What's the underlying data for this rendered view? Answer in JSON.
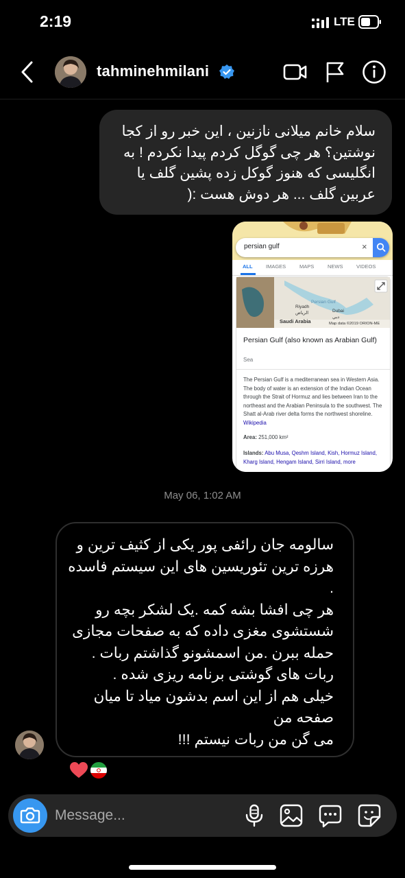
{
  "status": {
    "time": "2:19",
    "network": "LTE"
  },
  "header": {
    "username": "tahminehmilani"
  },
  "messages": {
    "outgoing_lines": [
      "سلام خانم میلانی نازنین ، این خبر رو از کجا",
      "نوشتین؟ هر چی گوگل کردم پیدا نکردم ! به",
      "انگلیسی که هنوز گوکل زده پشین گلف یا",
      "عربین گلف ... هر دوش هست :("
    ],
    "timestamp": "May 06, 1:02 AM",
    "incoming_lines": [
      "سالومه جان رائفی پور یکی از کثیف ترین و",
      "هرزه ترین تئوریسین های این سیستم فاسده",
      ".",
      "هر چی افشا بشه کمه .یک لشکر بچه رو",
      "شستشوی مغزی داده که به صفحات مجازی",
      "حمله ببرن .من اسمشونو گذاشتم ربات .",
      "ربات های گوشتی برنامه ریزی شده .",
      "خیلی هم از این اسم بدشون میاد تا میان",
      "صفحه من",
      "می گن من ربات نیستم !!!"
    ]
  },
  "screenshot": {
    "query": "persian gulf",
    "clear": "×",
    "tabs": [
      "ALL",
      "IMAGES",
      "MAPS",
      "NEWS",
      "VIDEOS"
    ],
    "map_labels": {
      "gulf": "Persian Gulf",
      "riyadh": "Riyadh",
      "riyadh_ar": "الرياض",
      "dubai": "Dubai",
      "dubai_ar": "دبي",
      "saudi": "Saudi Arabia",
      "credit": "Map data ©2019 ORION-ME"
    },
    "title": "Persian Gulf (also known as Arabian Gulf)",
    "subtitle": "Sea",
    "description": "The Persian Gulf is a mediterranean sea in Western Asia. The body of water is an extension of the Indian Ocean through the Strait of Hormuz and lies between Iran to the northeast and the Arabian Peninsula to the southwest. The Shatt al-Arab river delta forms the northwest shoreline.",
    "wiki": "Wikipedia",
    "area_label": "Area:",
    "area_value": "251,000 km²",
    "islands_label": "Islands:",
    "islands": "Abu Musa, Qeshm Island, Kish, Hormuz Island, Kharg Island, Hengam Island, Sirri Island, more"
  },
  "composer": {
    "placeholder": "Message..."
  },
  "colors": {
    "accent": "#3797f0",
    "bubble": "#262626",
    "heart": "#ed4956"
  }
}
